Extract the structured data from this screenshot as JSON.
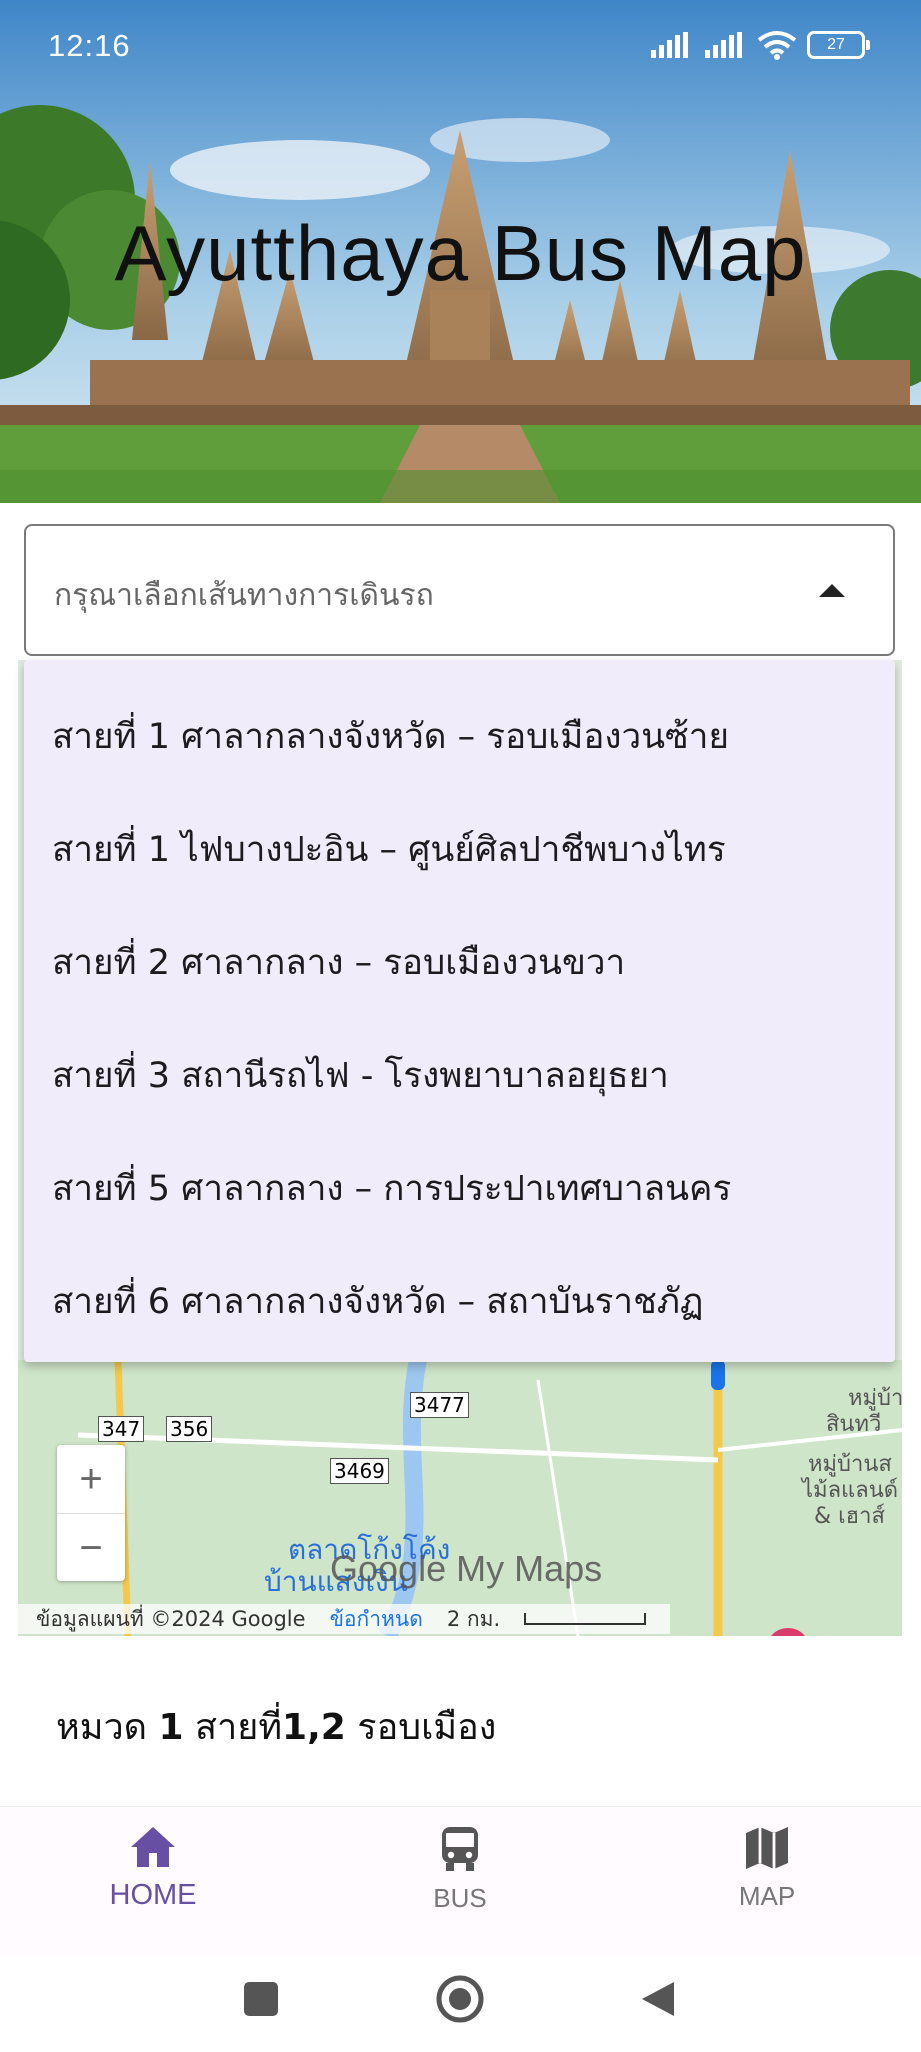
{
  "status_bar": {
    "time": "12:16",
    "battery": "27"
  },
  "header": {
    "title": "Ayutthaya Bus Map"
  },
  "route_select": {
    "placeholder": "กรุณาเลือกเส้นทางการเดินรถ",
    "options": [
      "สายที่ 1 ศาลากลางจังหวัด – รอบเมืองวนซ้าย",
      "สายที่ 1 ไฟบางปะอิน – ศูนย์ศิลปาชีพบางไทร",
      "สายที่ 2 ศาลากลาง – รอบเมืองวนขวา",
      "สายที่ 3 สถานีรถไฟ - โรงพยาบาลอยุธยา",
      "สายที่ 5 ศาลากลาง – การประปาเทศบาลนคร",
      "สายที่ 6 ศาลากลางจังหวัด – สถาบันราชภัฏ"
    ]
  },
  "map": {
    "zoom_in": "+",
    "zoom_out": "−",
    "watermark": "Google My Maps",
    "attribution": "ข้อมูลแผนที่ ©2024 Google",
    "terms": "ข้อกำหนด",
    "scale": "2 กม.",
    "labels": {
      "road_347": "347",
      "road_356": "356",
      "road_3477": "3477",
      "road_3469": "3469",
      "market": "ตลาดโก้งโค้ง",
      "market_2": "บ้านแสงเงิน",
      "village_1": "หมู่บ้าน",
      "village_1b": "สินทวี",
      "village_2": "หมู่บ้านส",
      "village_2b": "ไม้ลแลนด์",
      "village_2c": "& เฮาส์"
    }
  },
  "route_info": {
    "prefix": "หมวด",
    "group": "1",
    "middle": "สายที่",
    "lines": "1,2",
    "suffix": "รอบเมือง"
  },
  "bottom_nav": {
    "items": [
      {
        "label": "HOME",
        "icon": "home-icon",
        "active": true
      },
      {
        "label": "BUS",
        "icon": "bus-icon",
        "active": false
      },
      {
        "label": "MAP",
        "icon": "map-icon",
        "active": false
      }
    ]
  },
  "colors": {
    "accent": "#6750a4",
    "dropdown_bg": "#f1ecf9"
  }
}
